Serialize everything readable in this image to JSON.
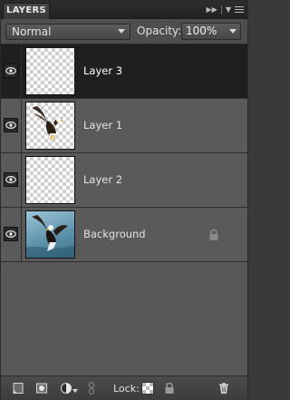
{
  "panel": {
    "tab_title": "LAYERS",
    "title_controls": [
      "expand-icon",
      "menu-icon"
    ]
  },
  "options": {
    "blend_mode": "Normal",
    "opacity_label": "Opacity:",
    "opacity_value": "100%"
  },
  "layers": [
    {
      "name": "Layer 3",
      "visible": true,
      "selected": true,
      "thumbnail": "transparent-checker",
      "locked": false
    },
    {
      "name": "Layer 1",
      "visible": true,
      "selected": false,
      "thumbnail": "eagle-transparent",
      "locked": false
    },
    {
      "name": "Layer 2",
      "visible": true,
      "selected": false,
      "thumbnail": "transparent-checker",
      "locked": false
    },
    {
      "name": "Background",
      "visible": true,
      "selected": false,
      "thumbnail": "eagle-photo",
      "locked": true
    }
  ],
  "bottom": {
    "lock_label": "Lock:",
    "buttons": [
      "new-layer-icon",
      "mask-icon",
      "adjustment-icon",
      "link-icon",
      "lock-transparency-icon",
      "lock-all-icon",
      "trash-icon"
    ]
  },
  "colors": {
    "panel_bg": "#555555",
    "selected_row": "#1f1f1f",
    "titlebar": "#222222"
  }
}
